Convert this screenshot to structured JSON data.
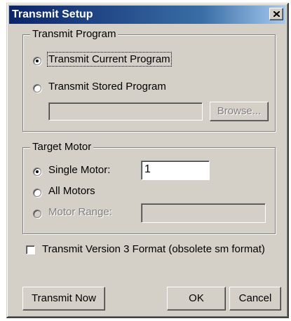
{
  "window": {
    "title": "Transmit Setup"
  },
  "transmit_program": {
    "legend": "Transmit Program",
    "option_current": "Transmit Current Program",
    "option_stored": "Transmit Stored Program",
    "selected": "current",
    "file_value": "",
    "browse_label": "Browse..."
  },
  "target_motor": {
    "legend": "Target Motor",
    "option_single": "Single Motor:",
    "single_value": "1",
    "option_all": "All Motors",
    "option_range": "Motor Range:",
    "range_value": "",
    "selected": "single"
  },
  "version3": {
    "label": "Transmit Version 3 Format (obsolete sm format)",
    "checked": false
  },
  "buttons": {
    "transmit_now": "Transmit Now",
    "ok": "OK",
    "cancel": "Cancel"
  },
  "icons": {
    "close": "close-icon"
  },
  "colors": {
    "titlebar_start": "#0a246a",
    "dialog_face": "#d4d0c8",
    "disabled_text": "#808080"
  }
}
